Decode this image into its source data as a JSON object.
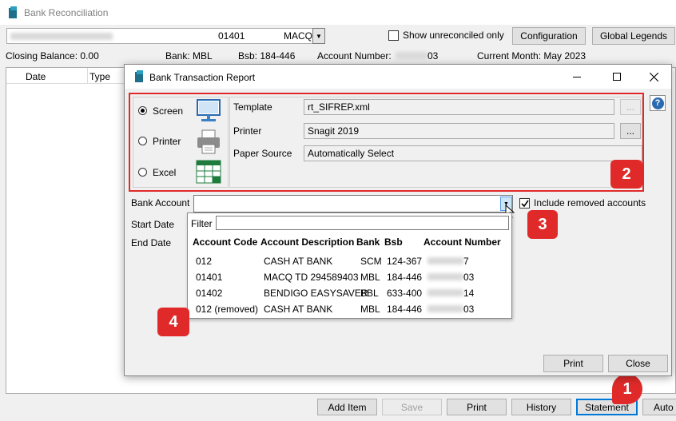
{
  "main_window": {
    "title": "Bank Reconciliation",
    "account_number": "01401",
    "account_name": "MACQ",
    "show_unreconciled_label": "Show unreconciled only",
    "configuration_label": "Configuration",
    "global_legends_label": "Global Legends",
    "closing_balance": "Closing Balance: 0.00",
    "bank": "Bank: MBL",
    "bsb": "Bsb: 184-446",
    "account_number_label": "Account Number:",
    "account_number_suffix": "03",
    "current_month": "Current Month: May 2023",
    "columns": [
      "Date",
      "Type"
    ],
    "footer_buttons": {
      "add_item": "Add Item",
      "save": "Save",
      "print": "Print",
      "history": "History",
      "statement": "Statement",
      "auto": "Auto"
    }
  },
  "dialog": {
    "title": "Bank Transaction Report",
    "output_options": [
      "Screen",
      "Printer",
      "Excel"
    ],
    "selected_output": "Screen",
    "template_label": "Template",
    "template_value": "rt_SIFREP.xml",
    "printer_label": "Printer",
    "printer_value": "Snagit 2019",
    "paper_source_label": "Paper Source",
    "paper_source_value": "Automatically Select",
    "browse_label": "...",
    "bank_account_label": "Bank Account",
    "include_removed_label": "Include removed accounts",
    "start_date_label": "Start Date",
    "end_date_label": "End Date",
    "print_label": "Print",
    "close_label": "Close",
    "help_label": "?"
  },
  "dropdown": {
    "filter_label": "Filter",
    "columns": [
      "Account Code",
      "Account Description",
      "Bank",
      "Bsb",
      "Account Number"
    ],
    "rows": [
      {
        "code": "012",
        "description": "CASH AT BANK",
        "bank": "SCM",
        "bsb": "124-367",
        "acct_suffix": "7"
      },
      {
        "code": "01401",
        "description": "MACQ TD 294589403",
        "bank": "MBL",
        "bsb": "184-446",
        "acct_suffix": "03"
      },
      {
        "code": "01402",
        "description": "BENDIGO EASYSAVER",
        "bank": "BBL",
        "bsb": "633-400",
        "acct_suffix": "14"
      },
      {
        "code": "012 (removed)",
        "description": "CASH AT BANK",
        "bank": "MBL",
        "bsb": "184-446",
        "acct_suffix": "03"
      }
    ]
  },
  "callouts": [
    "1",
    "2",
    "3",
    "4"
  ],
  "colors": {
    "callout": "#e02a2a",
    "highlight_border": "#e02a2a",
    "statement_border": "#0078d7"
  }
}
